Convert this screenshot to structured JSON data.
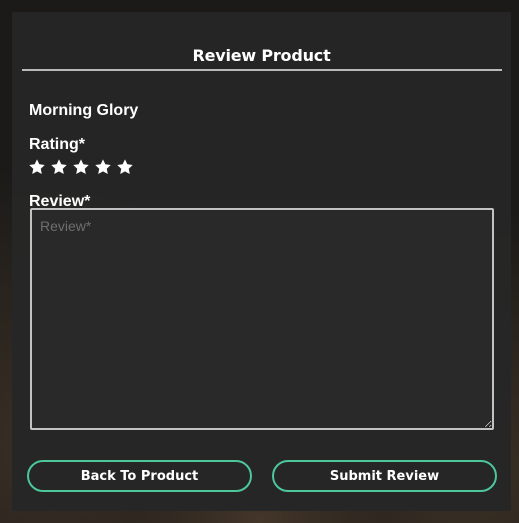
{
  "modal": {
    "title": "Review Product"
  },
  "product": {
    "name": "Morning Glory"
  },
  "rating": {
    "label": "Rating*",
    "max_stars": 5,
    "selected": 0
  },
  "review": {
    "label": "Review*",
    "placeholder": "Review*",
    "value": ""
  },
  "actions": {
    "back_label": "Back To Product",
    "submit_label": "Submit Review"
  },
  "colors": {
    "accent": "#4cc79a",
    "panel": "#262626",
    "text": "#ffffff",
    "placeholder": "#6f6f6f"
  },
  "icons": {
    "star": "star-icon"
  }
}
